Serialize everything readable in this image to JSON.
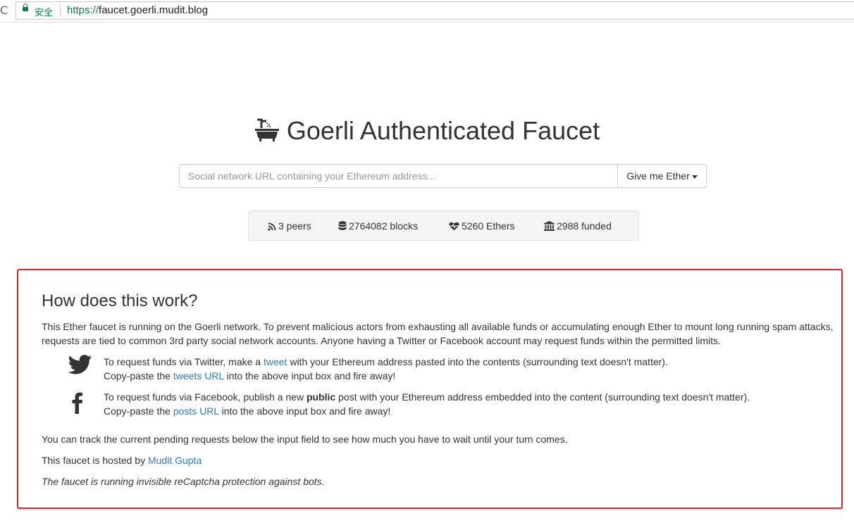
{
  "browser": {
    "reload_glyph": "C",
    "secure_label": "安全",
    "url_scheme": "https://",
    "url_host": "faucet.goerli.mudit.blog"
  },
  "header": {
    "title": "Goerli Authenticated Faucet",
    "icon": "bath-icon"
  },
  "form": {
    "placeholder": "Social network URL containing your Ethereum address...",
    "value": "",
    "button_label": "Give me Ether"
  },
  "stats": {
    "peers": "3 peers",
    "blocks": "2764082 blocks",
    "ethers": "5260 Ethers",
    "funded": "2988 funded"
  },
  "info": {
    "heading": "How does this work?",
    "intro": "This Ether faucet is running on the Goerli network. To prevent malicious actors from exhausting all available funds or accumulating enough Ether to mount long running spam attacks, requests are tied to common 3rd party social network accounts. Anyone having a Twitter or Facebook account may request funds within the permitted limits.",
    "twitter": {
      "line1_before": "To request funds via Twitter, make a ",
      "line1_link": "tweet",
      "line1_after": " with your Ethereum address pasted into the contents (surrounding text doesn't matter).",
      "line2_before": "Copy-paste the ",
      "line2_link": "tweets URL",
      "line2_after": " into the above input box and fire away!"
    },
    "facebook": {
      "line1_before": "To request funds via Facebook, publish a new ",
      "line1_bold": "public",
      "line1_after": " post with your Ethereum address embedded into the content (surrounding text doesn't matter).",
      "line2_before": "Copy-paste the ",
      "line2_link": "posts URL",
      "line2_after": " into the above input box and fire away!"
    },
    "track": "You can track the current pending requests below the input field to see how much you have to wait until your turn comes.",
    "hosted_before": "This faucet is hosted by ",
    "hosted_link": "Mudit Gupta",
    "recaptcha": "The faucet is running invisible reCaptcha protection against bots."
  },
  "colors": {
    "link": "#337ab7",
    "highlight_border": "#e8211d",
    "secure_green": "#0b8043"
  }
}
